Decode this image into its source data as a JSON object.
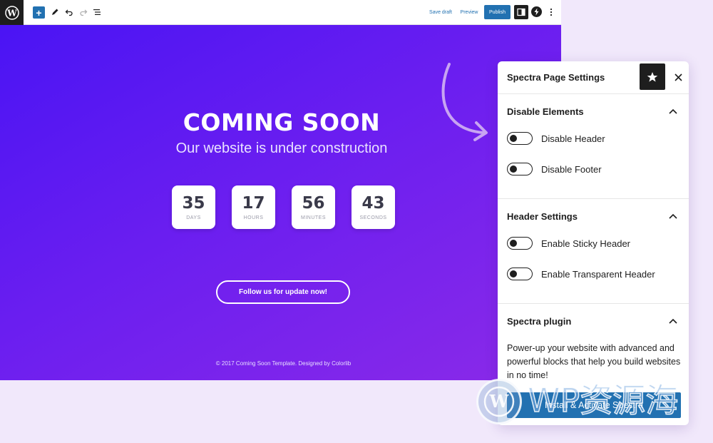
{
  "toolbar": {
    "save_draft": "Save draft",
    "preview": "Preview",
    "publish": "Publish",
    "add_block_symbol": "+"
  },
  "page": {
    "title": "COMING SOON",
    "subtitle": "Our website is under construction",
    "countdown": [
      {
        "value": "35",
        "label": "DAYS"
      },
      {
        "value": "17",
        "label": "HOURS"
      },
      {
        "value": "56",
        "label": "MINUTES"
      },
      {
        "value": "43",
        "label": "SECONDS"
      }
    ],
    "follow_button": "Follow us for update now!",
    "footer": "© 2017 Coming Soon Template. Designed by Colorlib"
  },
  "panel": {
    "title": "Spectra Page Settings",
    "sections": [
      {
        "title": "Disable Elements",
        "expanded": true,
        "toggles": [
          {
            "label": "Disable Header",
            "on": false
          },
          {
            "label": "Disable Footer",
            "on": false
          }
        ]
      },
      {
        "title": "Header Settings",
        "expanded": true,
        "toggles": [
          {
            "label": "Enable Sticky Header",
            "on": false
          },
          {
            "label": "Enable Transparent Header",
            "on": false
          }
        ]
      },
      {
        "title": "Spectra plugin",
        "expanded": true,
        "description": "Power-up your website with advanced and powerful blocks that help you build websites in no time!",
        "button": "Install & Activate Spectra"
      }
    ]
  },
  "watermark": {
    "text": "WP资源海"
  },
  "colors": {
    "accent": "#2271b1",
    "canvas_start": "#4a14f4",
    "canvas_end": "#8b2ae8",
    "dark": "#1e1e1e"
  }
}
